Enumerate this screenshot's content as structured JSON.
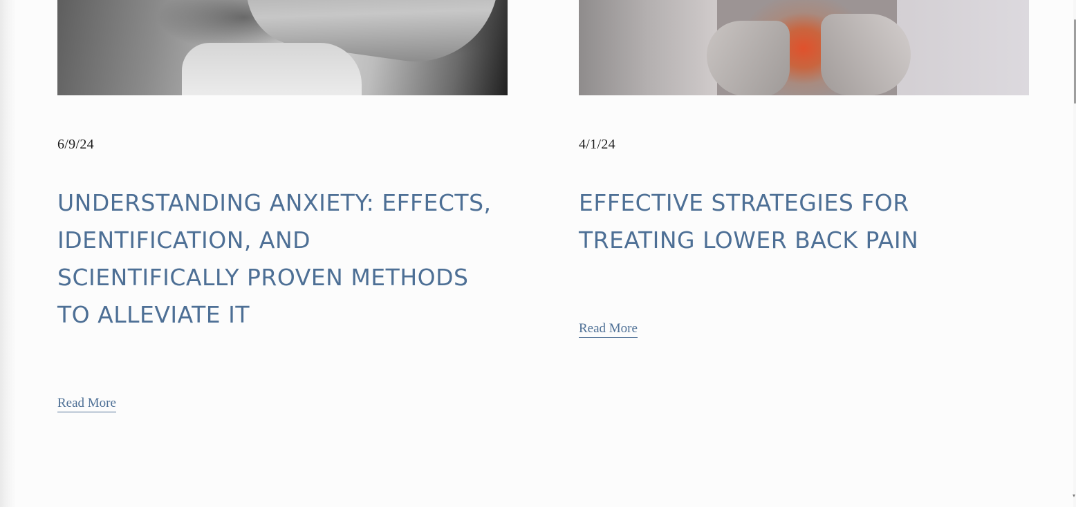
{
  "posts": [
    {
      "image_alt": "Black and white photo of a person holding their arm",
      "date": "6/9/24",
      "title": "UNDERSTANDING ANXIETY: EFFECTS, IDENTIFICATION, AND SCIENTIFICALLY PROVEN METHODS TO ALLEVIATE IT",
      "read_more": "Read More"
    },
    {
      "image_alt": "Person holding lower back with red highlighted pain area",
      "date": "4/1/24",
      "title": "EFFECTIVE STRATEGIES FOR TREATING LOWER BACK PAIN",
      "read_more": "Read More"
    }
  ],
  "colors": {
    "title": "#4d6f95",
    "link": "#4d6f95",
    "date": "#1a1a1a",
    "background": "#fcfcfc"
  }
}
